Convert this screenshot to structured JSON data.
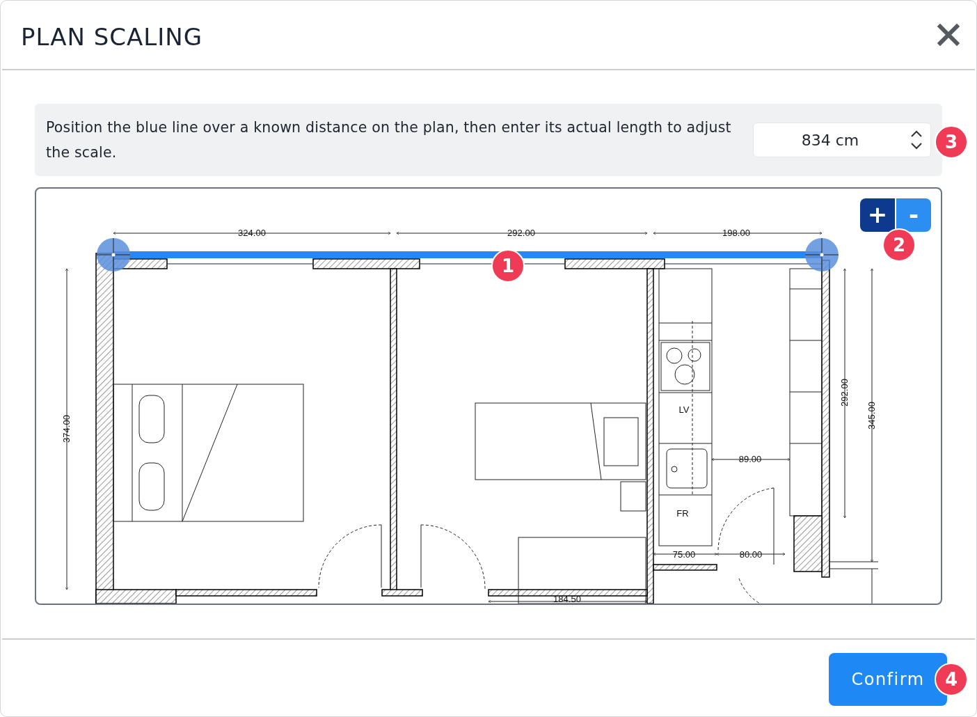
{
  "dialog": {
    "title": "PLAN SCALING"
  },
  "instructions": {
    "text": "Position the blue line over a known distance on the plan, then enter its actual length to adjust the scale.",
    "length_field": {
      "value": "834 cm"
    }
  },
  "plan": {
    "zoom_buttons": [
      {
        "label": "+",
        "kind": "zoom-in"
      },
      {
        "label": "-",
        "kind": "zoom-out"
      }
    ],
    "dimension_labels": [
      "324.00",
      "292.00",
      "198.00",
      "374.00",
      "292.00",
      "345.00",
      "89.00",
      "75.00",
      "80.00",
      "184.50"
    ],
    "room_labels": [
      "LV",
      "FR"
    ]
  },
  "callouts": [
    "1",
    "2",
    "3",
    "4"
  ],
  "footer": {
    "confirm": "Confirm"
  }
}
